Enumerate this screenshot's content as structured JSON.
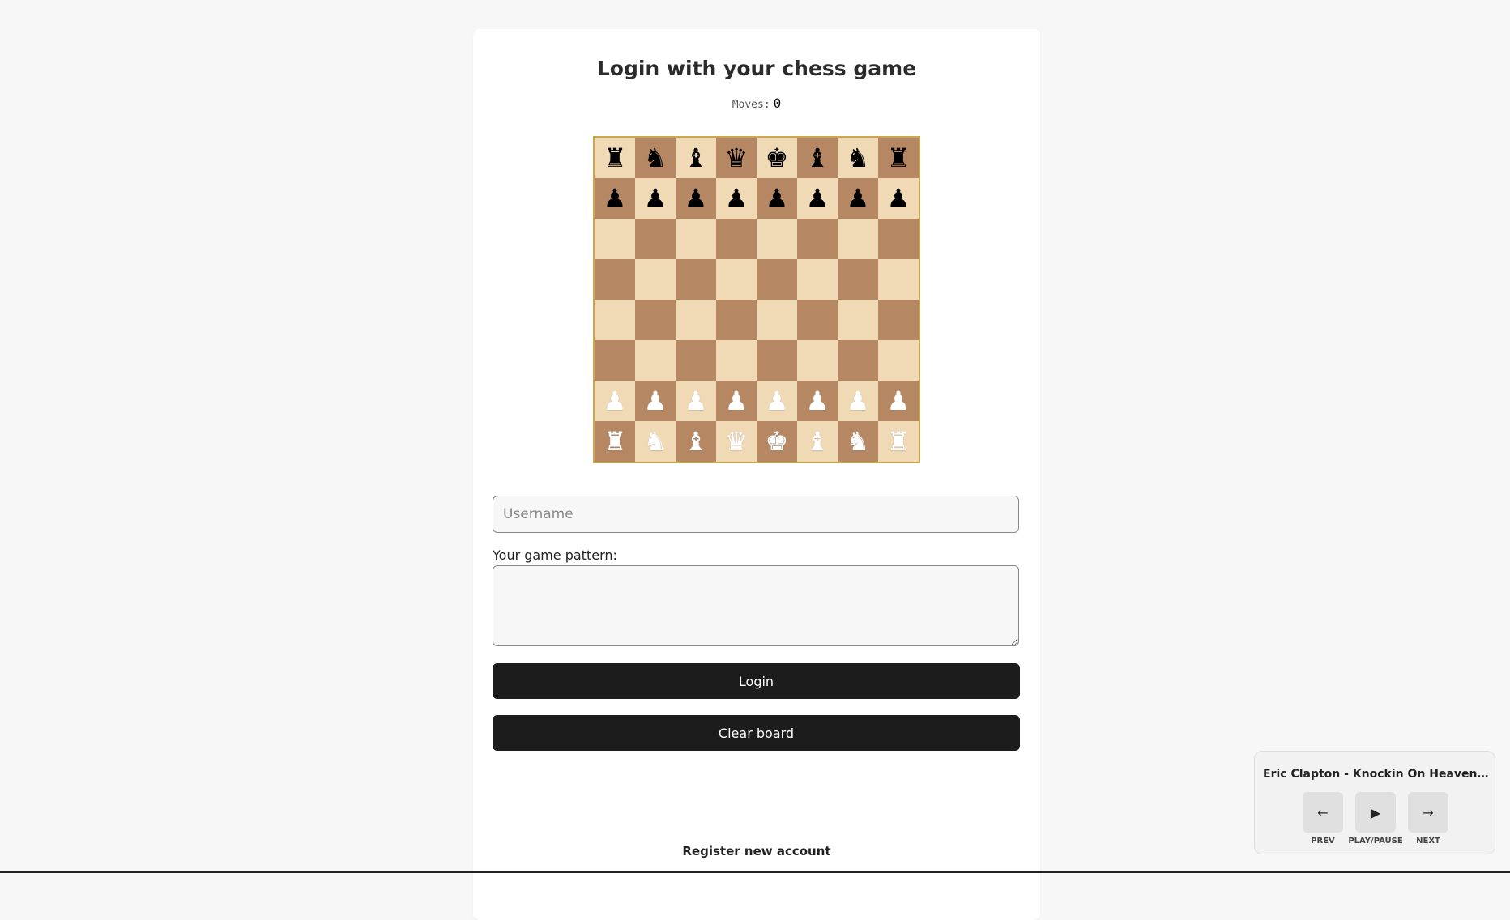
{
  "login": {
    "title": "Login with your chess game",
    "moves_label": "Moves:",
    "moves_count": "0",
    "username_placeholder": "Username",
    "username_value": "",
    "pattern_label": "Your game pattern:",
    "pattern_value": "",
    "login_label": "Login",
    "clear_label": "Clear board",
    "register_label": "Register new account"
  },
  "board": {
    "light_color": "#f0d9b5",
    "dark_color": "#b58863",
    "border_color": "#c9a74a",
    "rows": [
      [
        "♜",
        "♞",
        "♝",
        "♛",
        "♚",
        "♝",
        "♞",
        "♜"
      ],
      [
        "♟",
        "♟",
        "♟",
        "♟",
        "♟",
        "♟",
        "♟",
        "♟"
      ],
      [
        "",
        "",
        "",
        "",
        "",
        "",
        "",
        ""
      ],
      [
        "",
        "",
        "",
        "",
        "",
        "",
        "",
        ""
      ],
      [
        "",
        "",
        "",
        "",
        "",
        "",
        "",
        ""
      ],
      [
        "",
        "",
        "",
        "",
        "",
        "",
        "",
        ""
      ],
      [
        "♟",
        "♟",
        "♟",
        "♟",
        "♟",
        "♟",
        "♟",
        "♟"
      ],
      [
        "♜",
        "♞",
        "♝",
        "♛",
        "♚",
        "♝",
        "♞",
        "♜"
      ]
    ],
    "black_rows": [
      0,
      1
    ],
    "white_rows": [
      6,
      7
    ]
  },
  "player": {
    "track": "Eric Clapton - Knockin On Heaven s Do...",
    "prev_icon": "←",
    "play_icon": "▶",
    "next_icon": "→",
    "prev_label": "PREV",
    "play_label": "PLAY/PAUSE",
    "next_label": "NEXT"
  }
}
